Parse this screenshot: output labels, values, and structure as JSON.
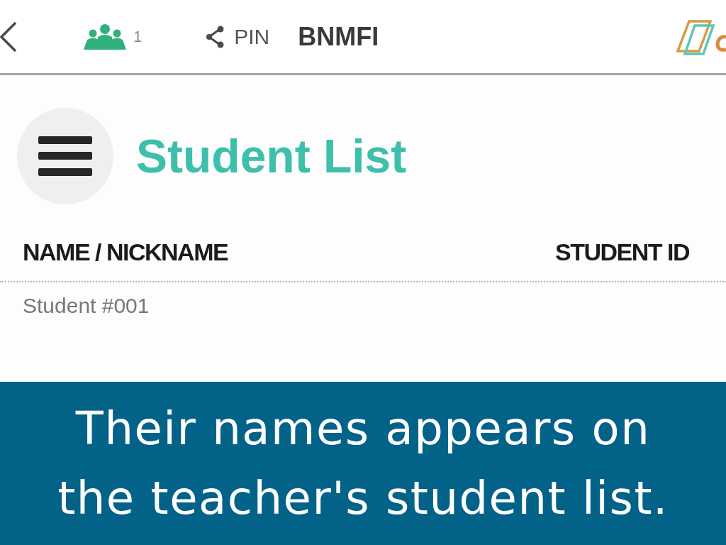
{
  "top_bar": {
    "student_count": "1",
    "pin_label": "PIN",
    "pin_code": "BNMFI"
  },
  "page": {
    "title": "Student List"
  },
  "table": {
    "columns": [
      "NAME / NICKNAME",
      "STUDENT ID"
    ],
    "rows": [
      {
        "name_nickname": "Student #001"
      }
    ]
  },
  "caption": "Their names appears on the teacher's student list."
}
